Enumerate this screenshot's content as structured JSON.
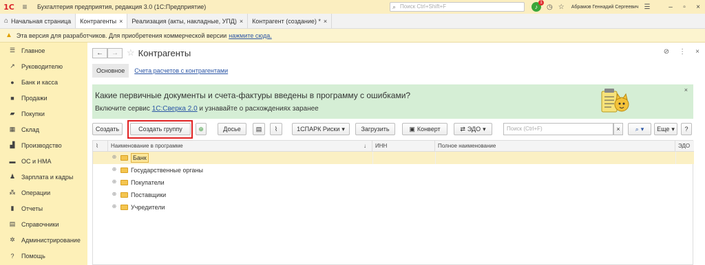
{
  "titlebar": {
    "logo": "1С",
    "title": "Бухгалтерия предприятия, редакция 3.0  (1С:Предприятие)",
    "search_placeholder": "Поиск Ctrl+Shift+F",
    "notifications": "1",
    "user": "Абрамов Геннадий Сергеевич"
  },
  "tabs": [
    {
      "label": "Начальная страница"
    },
    {
      "label": "Контрагенты"
    },
    {
      "label": "Реализация (акты, накладные, УПД)"
    },
    {
      "label": "Контрагент (создание) *"
    }
  ],
  "devbar": {
    "text": "Эта версия для разработчиков. Для приобретения коммерческой версии",
    "link": "нажмите сюда."
  },
  "sidebar": {
    "items": [
      {
        "label": "Главное",
        "icon": "menu-icon"
      },
      {
        "label": "Руководителю",
        "icon": "chart-icon"
      },
      {
        "label": "Банк и касса",
        "icon": "bank-icon"
      },
      {
        "label": "Продажи",
        "icon": "bag-icon"
      },
      {
        "label": "Покупки",
        "icon": "cart-icon"
      },
      {
        "label": "Склад",
        "icon": "warehouse-icon"
      },
      {
        "label": "Производство",
        "icon": "factory-icon"
      },
      {
        "label": "ОС и НМА",
        "icon": "truck-icon"
      },
      {
        "label": "Зарплата и кадры",
        "icon": "person-icon"
      },
      {
        "label": "Операции",
        "icon": "operations-icon"
      },
      {
        "label": "Отчеты",
        "icon": "report-icon"
      },
      {
        "label": "Справочники",
        "icon": "book-icon"
      },
      {
        "label": "Администрирование",
        "icon": "gear-icon"
      },
      {
        "label": "Помощь",
        "icon": "help-icon"
      }
    ]
  },
  "page": {
    "title": "Контрагенты",
    "subtab_main": "Основное",
    "subtab_link": "Счета расчетов с контрагентами"
  },
  "banner": {
    "line1": "Какие первичные документы и счета-фактуры введены в программу с ошибками?",
    "line2_pre": "Включите сервис ",
    "line2_link": "1С:Сверка 2.0",
    "line2_post": " и узнавайте о расхождениях заранее"
  },
  "toolbar": {
    "create": "Создать",
    "create_group": "Создать группу",
    "dossier": "Досье",
    "spark": "1СПАРК Риски",
    "load": "Загрузить",
    "envelope": "Конверт",
    "edo": "ЭДО",
    "search_placeholder": "Поиск (Ctrl+F)",
    "more": "Еще",
    "help": "?"
  },
  "grid": {
    "columns": [
      "Наименование в программе",
      "ИНН",
      "Полное наименование",
      "ЭДО"
    ],
    "rows": [
      {
        "name": "Банк"
      },
      {
        "name": "Государственные органы"
      },
      {
        "name": "Покупатели"
      },
      {
        "name": "Поставщики"
      },
      {
        "name": "Учредители"
      }
    ]
  }
}
